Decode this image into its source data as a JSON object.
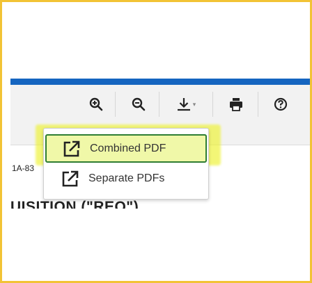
{
  "toolbar": {
    "zoom_in_icon": "zoom-in-icon",
    "zoom_out_icon": "zoom-out-icon",
    "download_icon": "download-icon",
    "download_caret": "▾",
    "print_icon": "print-icon",
    "help_icon": "help-icon"
  },
  "document": {
    "code_fragment": "1A-83",
    "title_fragment": "UISITION (\"REQ\")"
  },
  "download_menu": {
    "items": [
      {
        "label": "Combined PDF",
        "icon": "external-link-icon",
        "selected": true
      },
      {
        "label": "Separate PDFs",
        "icon": "external-link-icon",
        "selected": false
      }
    ]
  },
  "colors": {
    "frame": "#f2c335",
    "header_bar": "#1565c0",
    "highlight": "#eef22e",
    "selected_border": "#2e7d32"
  }
}
